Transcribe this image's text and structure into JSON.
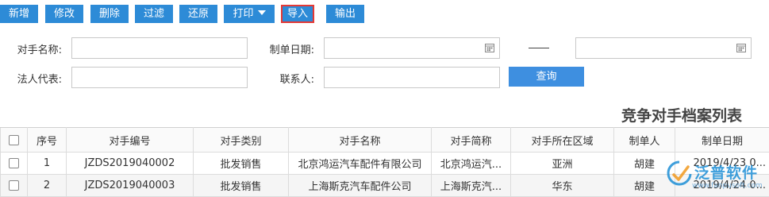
{
  "toolbar": {
    "buttons": [
      "新增",
      "修改",
      "删除",
      "过滤",
      "还原",
      "打印",
      "导入",
      "输出"
    ]
  },
  "filters": {
    "rival_name_label": "对手名称:",
    "create_date_label": "制单日期:",
    "legal_rep_label": "法人代表:",
    "contact_label": "联系人:",
    "date_separator": "——",
    "rival_name_value": "",
    "date_from_value": "",
    "date_to_value": "",
    "legal_rep_value": "",
    "contact_value": "",
    "query_button": "查询"
  },
  "report_title": "竞争对手档案列表",
  "table": {
    "headers": [
      "序号",
      "对手编号",
      "对手类别",
      "对手名称",
      "对手简称",
      "对手所在区域",
      "制单人",
      "制单日期"
    ],
    "rows": [
      {
        "seq": "1",
        "code": "JZDS2019040002",
        "category": "批发销售",
        "name": "北京鸿运汽车配件有限公司",
        "short_name": "北京鸿运汽...",
        "region": "亚洲",
        "creator": "胡建",
        "date": "2019/4/23 0..."
      },
      {
        "seq": "2",
        "code": "JZDS2019040003",
        "category": "批发销售",
        "name": "上海斯克汽车配件公司",
        "short_name": "上海斯克汽...",
        "region": "华东",
        "creator": "胡建",
        "date": "2019/4/24 0..."
      }
    ]
  },
  "watermark": {
    "brand": "泛普软件",
    "url": "www.fanpusoft.com"
  },
  "colors": {
    "button_blue": "#2d8bd7",
    "highlight_red": "#e53935",
    "link_blue": "#1a57b8"
  }
}
